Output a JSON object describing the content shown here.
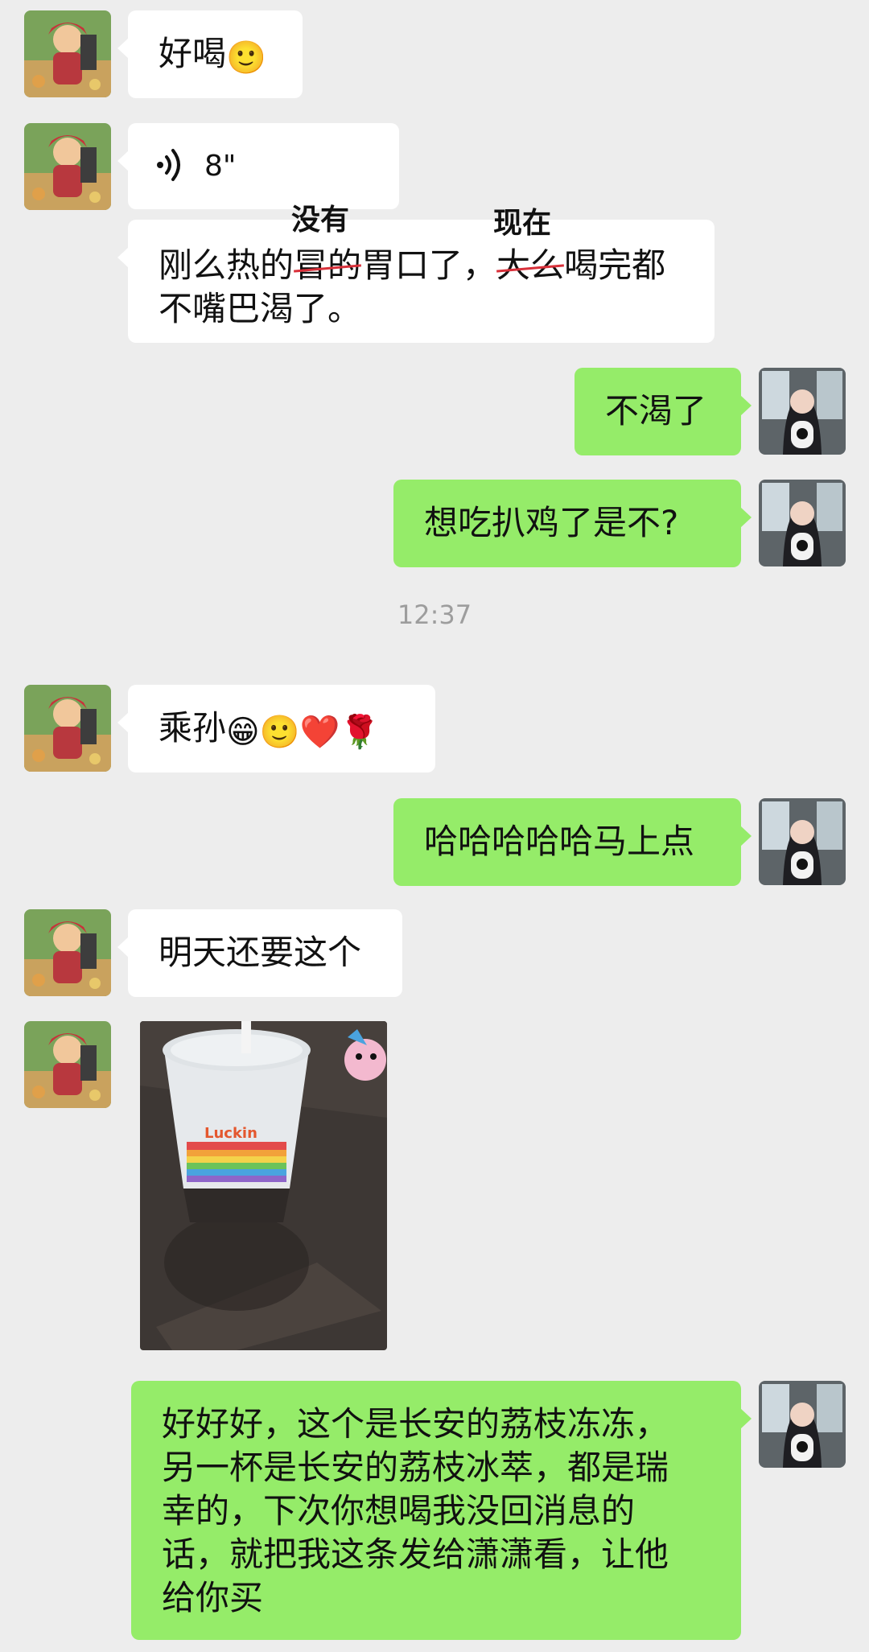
{
  "messages": {
    "m1": {
      "text": "好喝",
      "emoji": "🙂"
    },
    "m2": {
      "duration": "8\""
    },
    "m3": {
      "seg1": "刚么热的",
      "strike1": "冒的",
      "seg2": "胃口了，",
      "strike2": "大么",
      "seg3": "喝完都",
      "line2": "不嘴巴渴了。",
      "annot1": "没有",
      "annot2": "现在"
    },
    "m4": {
      "text": "不渴了"
    },
    "m5": {
      "text": "想吃扒鸡了是不?"
    },
    "time": "12:37",
    "m6": {
      "text": "乘孙",
      "emojis": [
        "😁",
        "🙂",
        "❤️",
        "🌹"
      ]
    },
    "m7": {
      "text": "哈哈哈哈哈马上点"
    },
    "m8": {
      "text": "明天还要这个"
    },
    "m10": {
      "line1": "好好好，这个是长安的荔枝冻冻，",
      "line2": "另一杯是长安的荔枝冰萃，都是瑞",
      "line3": "幸的，下次你想喝我没回消息的",
      "line4": "话，就把我这条发给潇潇看，让他",
      "line5": "给你买"
    }
  },
  "photo": {
    "cup_brand": "Luckin"
  },
  "colors": {
    "incoming": "#ffffff",
    "outgoing": "#95ec69",
    "background": "#ededed"
  }
}
